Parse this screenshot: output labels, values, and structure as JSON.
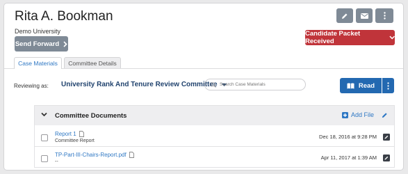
{
  "profile": {
    "name": "Rita A. Bookman",
    "institution": "Demo University"
  },
  "actions": {
    "send_forward": "Send Forward",
    "status": "Candidate Packet Received"
  },
  "tabs": [
    {
      "label": "Case Materials",
      "active": true
    },
    {
      "label": "Committee Details",
      "active": false
    }
  ],
  "review": {
    "label": "Reviewing as:",
    "committee": "University Rank And Tenure Review Committee"
  },
  "search": {
    "placeholder": "Search Case Materials"
  },
  "read_button": "Read",
  "section": {
    "title": "Committee Documents",
    "add_file": "Add File"
  },
  "documents": [
    {
      "title": "Report 1",
      "subtitle": "Committee Report",
      "date": "Dec 18, 2016 at 9:28 PM"
    },
    {
      "title": "TP-Part-III-Chairs-Report.pdf",
      "subtitle": "--",
      "date": "Apr 11, 2017 at 1:39 AM"
    }
  ],
  "colors": {
    "primary": "#2369b1",
    "status_red": "#c0343a",
    "gray_button": "#7f8a96",
    "link": "#2f78c4"
  }
}
